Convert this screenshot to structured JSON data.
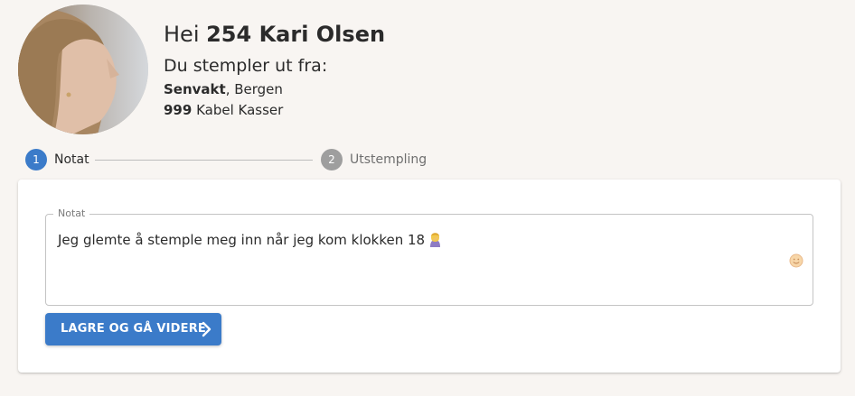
{
  "user": {
    "greeting_prefix": "Hei ",
    "name": "254 Kari Olsen"
  },
  "clock_out": {
    "label": "Du stempler ut fra:",
    "shift_type": "Senvakt",
    "location_suffix": ", Bergen",
    "department_code": "999",
    "department_name": " Kabel Kasser"
  },
  "steps": [
    {
      "number": "1",
      "label": "Notat",
      "state": "active",
      "color": "#3b7bc9"
    },
    {
      "number": "2",
      "label": "Utstempling",
      "state": "inactive",
      "color": "#9e9e9e"
    }
  ],
  "note": {
    "legend": "Notat",
    "value": "Jeg glemte å stemple meg inn når jeg kom klokken 18",
    "inline_emoji_icon": "person-facepalming-icon",
    "emoji_button_icon": "smiley-icon"
  },
  "actions": {
    "save_label": "LAGRE OG GÅ VIDERE",
    "save_icon": "chevron-right-icon"
  },
  "colors": {
    "accent": "#3b7bc9",
    "background": "#f8f5f2",
    "card": "#ffffff"
  }
}
